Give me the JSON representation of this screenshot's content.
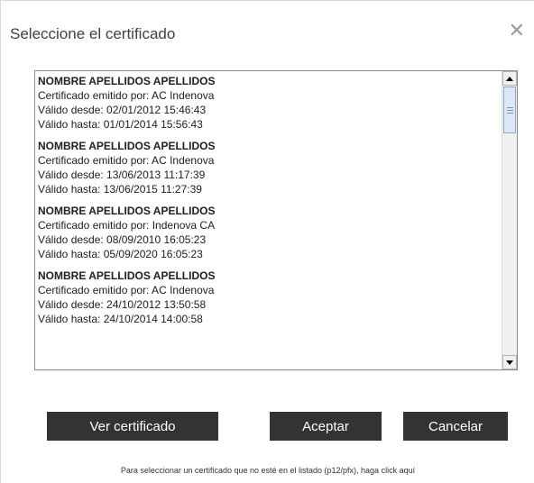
{
  "dialog": {
    "title": "Seleccione el certificado",
    "close_symbol": "✕"
  },
  "certificates": [
    {
      "name": "NOMBRE APELLIDOS APELLIDOS",
      "issuer": "Certificado emitido por: AC Indenova",
      "valid_from": "Válido desde: 02/01/2012 15:46:43",
      "valid_to": "Válido hasta: 01/01/2014 15:56:43"
    },
    {
      "name": "NOMBRE APELLIDOS APELLIDOS",
      "issuer": "Certificado emitido por: AC Indenova",
      "valid_from": "Válido desde: 13/06/2013 11:17:39",
      "valid_to": "Válido hasta: 13/06/2015 11:27:39"
    },
    {
      "name": "NOMBRE APELLIDOS APELLIDOS",
      "issuer": "Certificado emitido por: Indenova CA",
      "valid_from": "Válido desde: 08/09/2010 16:05:23",
      "valid_to": "Válido hasta: 05/09/2020 16:05:23"
    },
    {
      "name": "NOMBRE APELLIDOS APELLIDOS",
      "issuer": "Certificado emitido por: AC Indenova",
      "valid_from": "Válido desde: 24/10/2012 13:50:58",
      "valid_to": "Válido hasta: 24/10/2014 14:00:58"
    }
  ],
  "scrollbar": {
    "up_icon": "scroll-up-arrow-icon",
    "down_icon": "scroll-down-arrow-icon"
  },
  "buttons": {
    "view_label": "Ver certificado",
    "accept_label": "Aceptar",
    "cancel_label": "Cancelar"
  },
  "footer": {
    "link_text": "Para seleccionar un certificado que no esté en el listado (p12/pfx), haga click aquí"
  },
  "colors": {
    "button_bg": "#333333",
    "button_text": "#ffffff",
    "title_text": "#404040"
  }
}
